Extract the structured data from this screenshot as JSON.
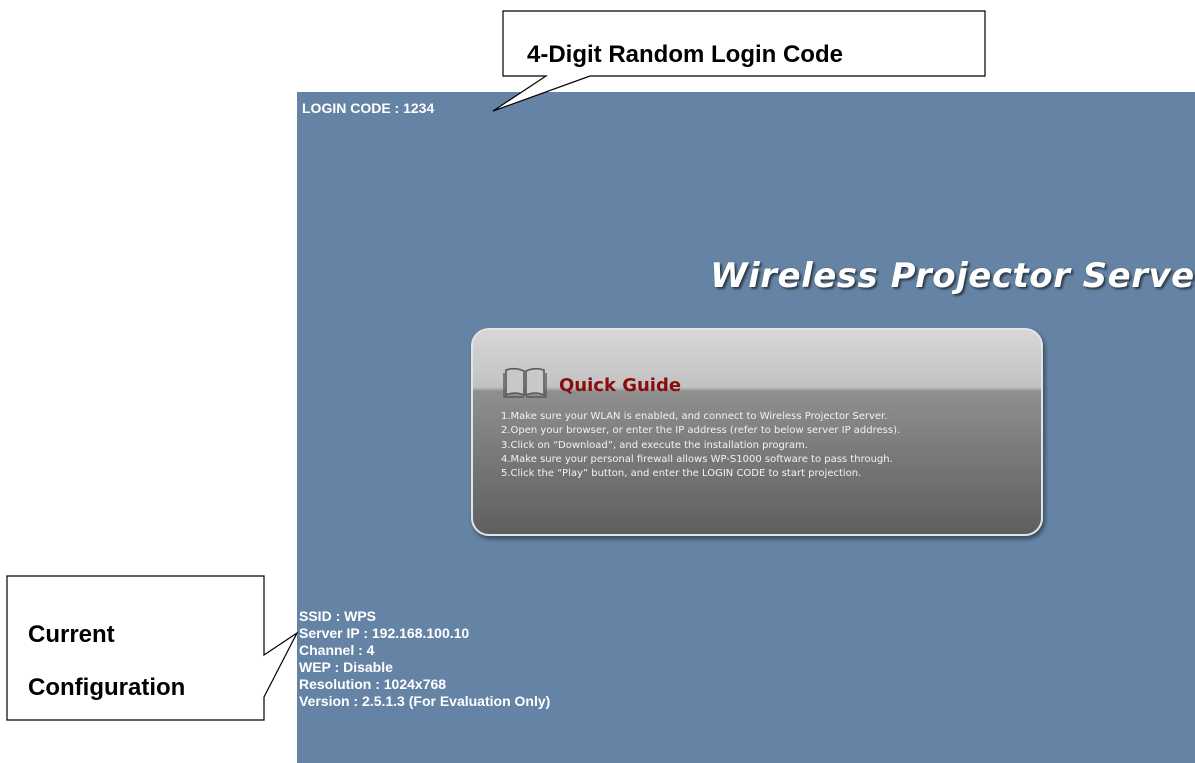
{
  "screen": {
    "login_code": "LOGIN CODE : 1234",
    "title": "Wireless Projector Server",
    "quick_guide": {
      "icon": "open-book-icon",
      "title": "Quick Guide",
      "steps": [
        "1.Make sure your WLAN is enabled, and connect to Wireless Projector Server.",
        "2.Open your browser, or enter the IP address (refer to below server IP address).",
        "3.Click on “Download”, and execute the installation program.",
        "4.Make sure your personal firewall allows WP-S1000 software to pass through.",
        "5.Click the “Play” button, and enter the LOGIN CODE to start projection."
      ]
    },
    "config": {
      "ssid": "SSID : WPS",
      "server_ip": "Server IP : 192.168.100.10",
      "channel": "Channel : 4",
      "wep": "WEP : Disable",
      "resolution": "Resolution : 1024x768",
      "version": "Version : 2.5.1.3 (For Evaluation Only)"
    }
  },
  "callouts": {
    "top": "4-Digit Random Login Code",
    "left_line1": "Current",
    "left_line2": "Configuration"
  },
  "colors": {
    "screen_bg": "#6584a5",
    "guide_title": "#8a0c0c",
    "text": "#ffffff"
  }
}
